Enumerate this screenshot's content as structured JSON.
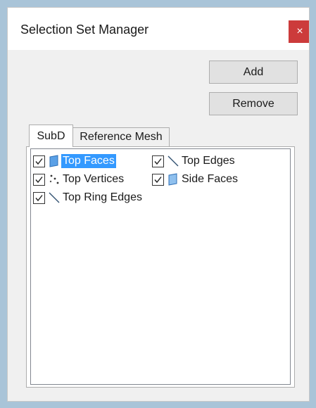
{
  "window": {
    "title": "Selection Set Manager",
    "close_glyph": "×"
  },
  "buttons": {
    "add_label": "Add",
    "remove_label": "Remove"
  },
  "tabs": [
    {
      "label": "SubD",
      "active": true
    },
    {
      "label": "Reference Mesh",
      "active": false
    }
  ],
  "selection_sets": [
    {
      "label": "Top Faces",
      "checked": true,
      "icon": "face-icon",
      "selected": true
    },
    {
      "label": "Top Edges",
      "checked": true,
      "icon": "edge-icon",
      "selected": false
    },
    {
      "label": "Top Vertices",
      "checked": true,
      "icon": "vertices-icon",
      "selected": false
    },
    {
      "label": "Side Faces",
      "checked": true,
      "icon": "face-icon",
      "selected": false
    },
    {
      "label": "Top Ring Edges",
      "checked": true,
      "icon": "edge-icon",
      "selected": false
    }
  ],
  "colors": {
    "frame_border": "#a9c4d8",
    "close_button": "#cc3b3b",
    "selection_highlight": "#3399ff",
    "face_icon": "#5aa0e6"
  }
}
